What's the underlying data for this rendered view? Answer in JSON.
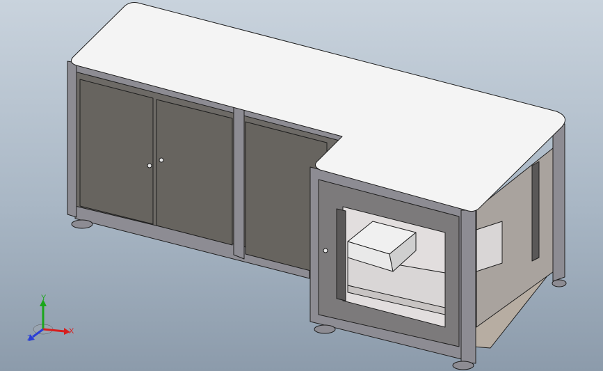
{
  "view": {
    "background_top": "#c9d3dd",
    "background_bottom": "#8c9bab",
    "model": {
      "top_color": "#f4f4f4",
      "panel_color": "#6d6a66",
      "frame_color": "#8d8c93",
      "edge_color": "#1e1e1e",
      "shelf_color": "#d9d6d6",
      "floor_color": "#b7ada2",
      "box_color": "#e9e9e9"
    },
    "triad": {
      "x_label": "X",
      "y_label": "Y",
      "z_label": "Z",
      "x_color": "#d61f1f",
      "y_color": "#1ba61b",
      "z_color": "#2a3fd6"
    }
  }
}
